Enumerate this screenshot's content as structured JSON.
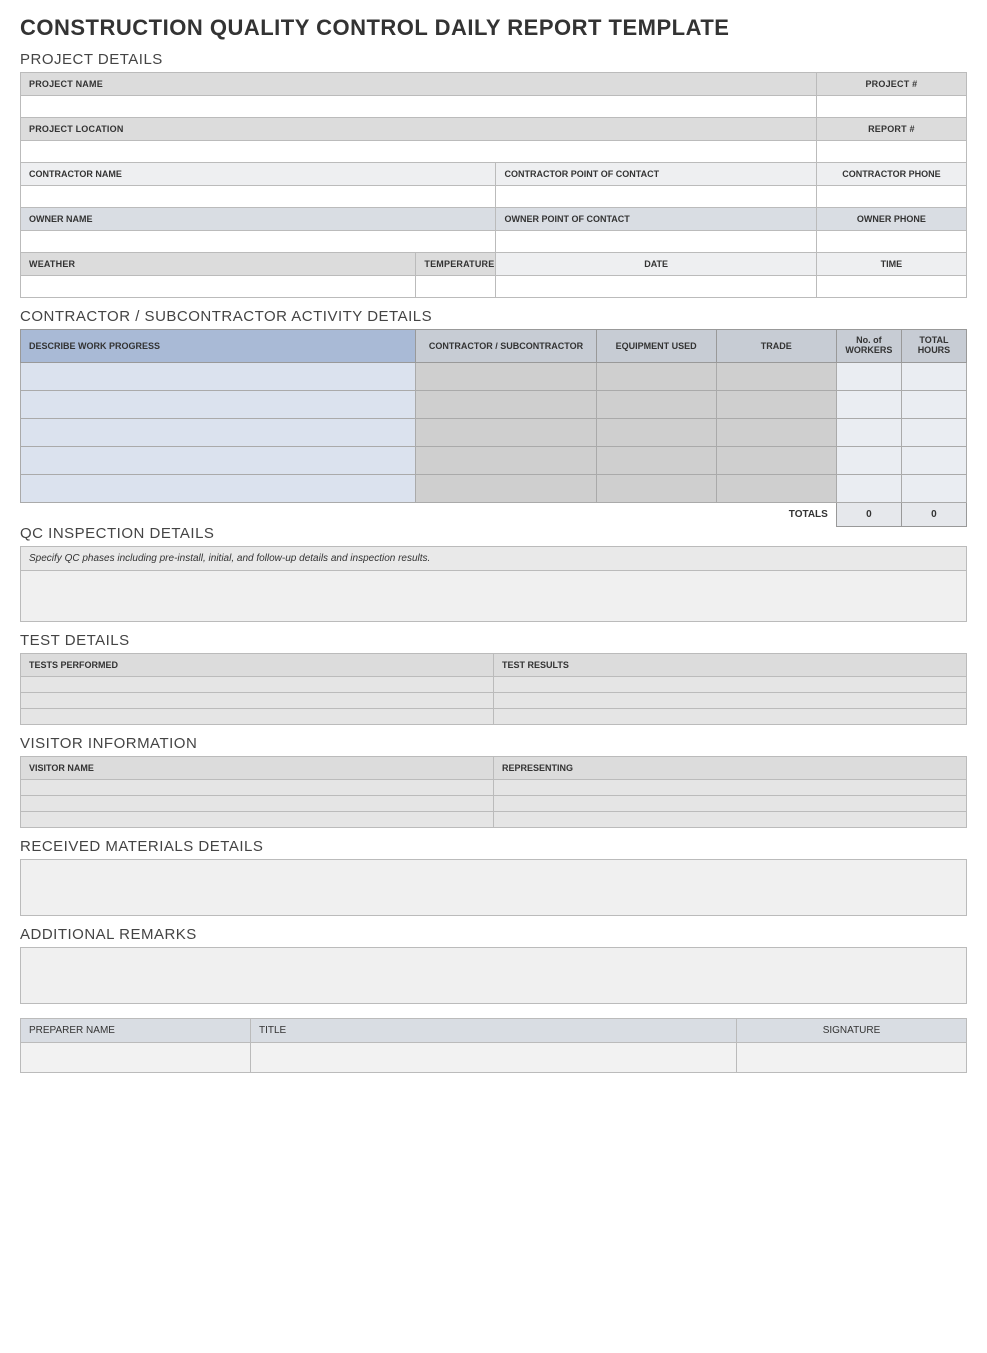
{
  "title": "CONSTRUCTION QUALITY CONTROL DAILY REPORT TEMPLATE",
  "sections": {
    "project": {
      "heading": "PROJECT DETAILS",
      "labels": {
        "project_name": "PROJECT NAME",
        "project_no": "PROJECT #",
        "project_location": "PROJECT LOCATION",
        "report_no": "REPORT #",
        "contractor_name": "CONTRACTOR NAME",
        "contractor_poc": "CONTRACTOR POINT OF CONTACT",
        "contractor_phone": "CONTRACTOR PHONE",
        "owner_name": "OWNER NAME",
        "owner_poc": "OWNER POINT OF CONTACT",
        "owner_phone": "OWNER PHONE",
        "weather": "WEATHER",
        "temperature": "TEMPERATURE",
        "date": "DATE",
        "time": "TIME"
      },
      "values": {
        "project_name": "",
        "project_no": "",
        "project_location": "",
        "report_no": "",
        "contractor_name": "",
        "contractor_poc": "",
        "contractor_phone": "",
        "owner_name": "",
        "owner_poc": "",
        "owner_phone": "",
        "weather": "",
        "temperature": "",
        "date": "",
        "time": ""
      }
    },
    "activity": {
      "heading": "CONTRACTOR / SUBCONTRACTOR ACTIVITY DETAILS",
      "columns": {
        "progress": "DESCRIBE WORK PROGRESS",
        "contractor": "CONTRACTOR / SUBCONTRACTOR",
        "equipment": "EQUIPMENT USED",
        "trade": "TRADE",
        "workers": "No. of WORKERS",
        "hours": "TOTAL HOURS"
      },
      "rows": [
        {
          "progress": "",
          "contractor": "",
          "equipment": "",
          "trade": "",
          "workers": "",
          "hours": ""
        },
        {
          "progress": "",
          "contractor": "",
          "equipment": "",
          "trade": "",
          "workers": "",
          "hours": ""
        },
        {
          "progress": "",
          "contractor": "",
          "equipment": "",
          "trade": "",
          "workers": "",
          "hours": ""
        },
        {
          "progress": "",
          "contractor": "",
          "equipment": "",
          "trade": "",
          "workers": "",
          "hours": ""
        },
        {
          "progress": "",
          "contractor": "",
          "equipment": "",
          "trade": "",
          "workers": "",
          "hours": ""
        }
      ],
      "totals_label": "TOTALS",
      "totals_workers": "0",
      "totals_hours": "0"
    },
    "qc": {
      "heading": "QC INSPECTION DETAILS",
      "hint": "Specify QC phases including pre-install, initial, and follow-up details and inspection results.",
      "value": ""
    },
    "test": {
      "heading": "TEST DETAILS",
      "columns": {
        "performed": "TESTS PERFORMED",
        "results": "TEST RESULTS"
      },
      "rows": [
        {
          "performed": "",
          "results": ""
        },
        {
          "performed": "",
          "results": ""
        },
        {
          "performed": "",
          "results": ""
        }
      ]
    },
    "visitor": {
      "heading": "VISITOR INFORMATION",
      "columns": {
        "name": "VISITOR NAME",
        "representing": "REPRESENTING"
      },
      "rows": [
        {
          "name": "",
          "representing": ""
        },
        {
          "name": "",
          "representing": ""
        },
        {
          "name": "",
          "representing": ""
        }
      ]
    },
    "materials": {
      "heading": "RECEIVED MATERIALS DETAILS",
      "value": ""
    },
    "remarks": {
      "heading": "ADDITIONAL REMARKS",
      "value": ""
    },
    "sign": {
      "labels": {
        "preparer": "PREPARER NAME",
        "title": "TITLE",
        "signature": "SIGNATURE"
      },
      "values": {
        "preparer": "",
        "title": "",
        "signature": ""
      }
    }
  }
}
